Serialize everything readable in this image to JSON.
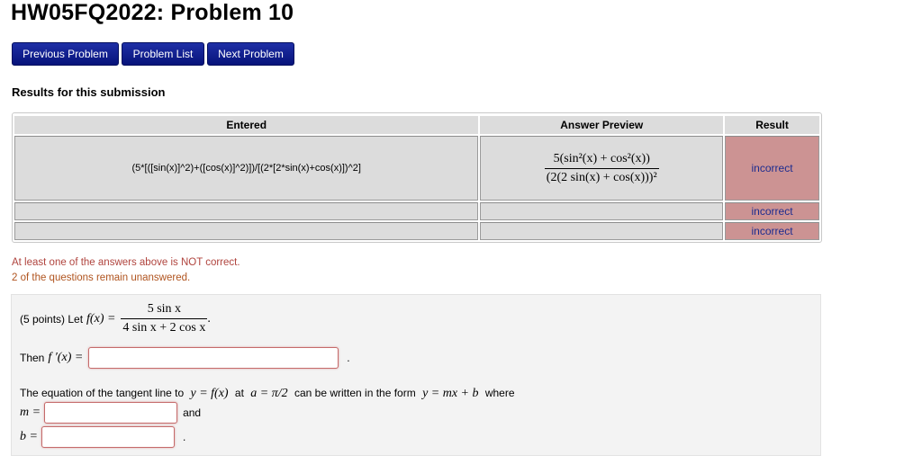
{
  "page": {
    "title": "HW05FQ2022: Problem 10"
  },
  "nav": {
    "previous": "Previous Problem",
    "list": "Problem List",
    "next": "Next Problem"
  },
  "results": {
    "heading": "Results for this submission",
    "columns": [
      "Entered",
      "Answer Preview",
      "Result"
    ],
    "rows": [
      {
        "entered": "(5*[([sin(x)]^2)+([cos(x)]^2)])/[(2*[2*sin(x)+cos(x)])^2]",
        "preview_numerator": "5(sin²(x) + cos²(x))",
        "preview_denominator": "(2(2 sin(x) + cos(x)))²",
        "result": "incorrect"
      },
      {
        "entered": "",
        "result": "incorrect"
      },
      {
        "entered": "",
        "result": "incorrect"
      }
    ],
    "colors": {
      "incorrect_bg": "#cc9393",
      "incorrect_text": "#1d2c8f",
      "cell_bg": "#dcdcdc"
    }
  },
  "messages": {
    "not_correct": "At least one of the answers above is NOT correct.",
    "unanswered": "2 of the questions remain unanswered."
  },
  "problem": {
    "points_label": "(5 points) Let",
    "f_lhs": "f(x) =",
    "f_num": "5 sin x",
    "f_den": "4 sin x + 2 cos x",
    "period": ".",
    "then_label": "Then",
    "fprime_lhs": "f ′(x) =",
    "fprime_value": "",
    "tangent_text_1": "The equation of the tangent line to",
    "tangent_math_1": "y = f(x)",
    "tangent_text_2": "at",
    "tangent_math_2": "a = π/2",
    "tangent_text_3": "can be written in the form",
    "tangent_math_3": "y = mx + b",
    "tangent_text_4": "where",
    "m_label": "m =",
    "m_value": "",
    "and_label": "and",
    "b_label": "b =",
    "b_value": ""
  }
}
